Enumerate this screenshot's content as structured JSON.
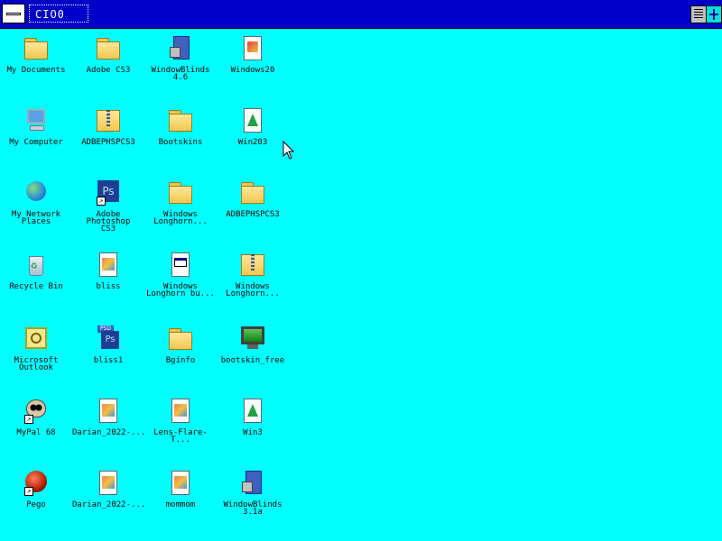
{
  "window": {
    "title_value": "CIO0",
    "colors": {
      "desktop": "#00ffff",
      "titlebar": "#0000c8"
    }
  },
  "titlebar": {
    "system_menu_icon": "system-menu-icon",
    "minimize_icon": "minimize-icon",
    "add_icon": "plus-icon"
  },
  "icons": [
    {
      "label": "My Documents",
      "glyph": "documents-folder-icon"
    },
    {
      "label": "Adobe CS3",
      "glyph": "folder-icon"
    },
    {
      "label": "WindowBlinds\n4.6",
      "glyph": "setup-icon"
    },
    {
      "label": "Windows20",
      "glyph": "paint-document-icon"
    },
    {
      "label": "My Computer",
      "glyph": "computer-icon"
    },
    {
      "label": "ADBEPHSPCS3",
      "glyph": "zip-folder-icon"
    },
    {
      "label": "Bootskins",
      "glyph": "folder-icon"
    },
    {
      "label": "Win203",
      "glyph": "tree-document-icon"
    },
    {
      "label": "My Network\nPlaces",
      "glyph": "network-globe-icon"
    },
    {
      "label": "Adobe Photoshop\nCS3",
      "glyph": "photoshop-icon"
    },
    {
      "label": "Windows\nLonghorn...",
      "glyph": "folder-icon"
    },
    {
      "label": "ADBEPHSPCS3",
      "glyph": "folder-icon"
    },
    {
      "label": "Recycle Bin",
      "glyph": "recycle-bin-icon"
    },
    {
      "label": "bliss",
      "glyph": "image-document-icon"
    },
    {
      "label": "Windows\nLonghorn bu...",
      "glyph": "window-document-icon"
    },
    {
      "label": "Windows\nLonghorn...",
      "glyph": "zip-folder-icon"
    },
    {
      "label": "Microsoft\nOutlook",
      "glyph": "outlook-icon"
    },
    {
      "label": "bliss1",
      "glyph": "psd-file-icon"
    },
    {
      "label": "Bginfo",
      "glyph": "folder-icon"
    },
    {
      "label": "bootskin_free",
      "glyph": "monitor-icon"
    },
    {
      "label": "MyPal 68",
      "glyph": "raccoon-icon"
    },
    {
      "label": "Darian_2022-...",
      "glyph": "image-document-icon"
    },
    {
      "label": "Lens-Flare-T...",
      "glyph": "image-document-icon"
    },
    {
      "label": "Win3",
      "glyph": "tree-document-icon"
    },
    {
      "label": "Pego",
      "glyph": "pego-icon"
    },
    {
      "label": "Darian_2022-...",
      "glyph": "image-document-icon"
    },
    {
      "label": "mommom",
      "glyph": "image-document-icon"
    },
    {
      "label": "WindowBlinds\n3.1a",
      "glyph": "setup-icon"
    }
  ]
}
